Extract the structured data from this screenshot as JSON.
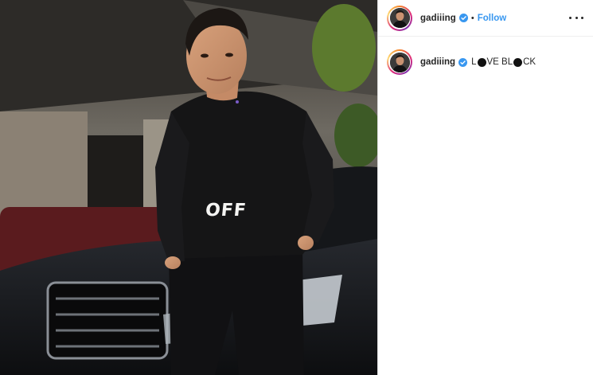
{
  "post": {
    "username": "gadiiing",
    "verified": true,
    "separator": "•",
    "follow_label": "Follow",
    "more_icon": "more-horizontal-icon",
    "caption": {
      "username": "gadiiing",
      "text_part1": "L",
      "emoji1": "black-circle",
      "text_part2": "VE BL",
      "emoji2": "black-circle",
      "text_part3": "CK"
    }
  },
  "photo": {
    "sweater_print": "OFF"
  },
  "colors": {
    "follow": "#3897f0",
    "verified_badge": "#3897f0",
    "divider": "#dbdbdb"
  }
}
